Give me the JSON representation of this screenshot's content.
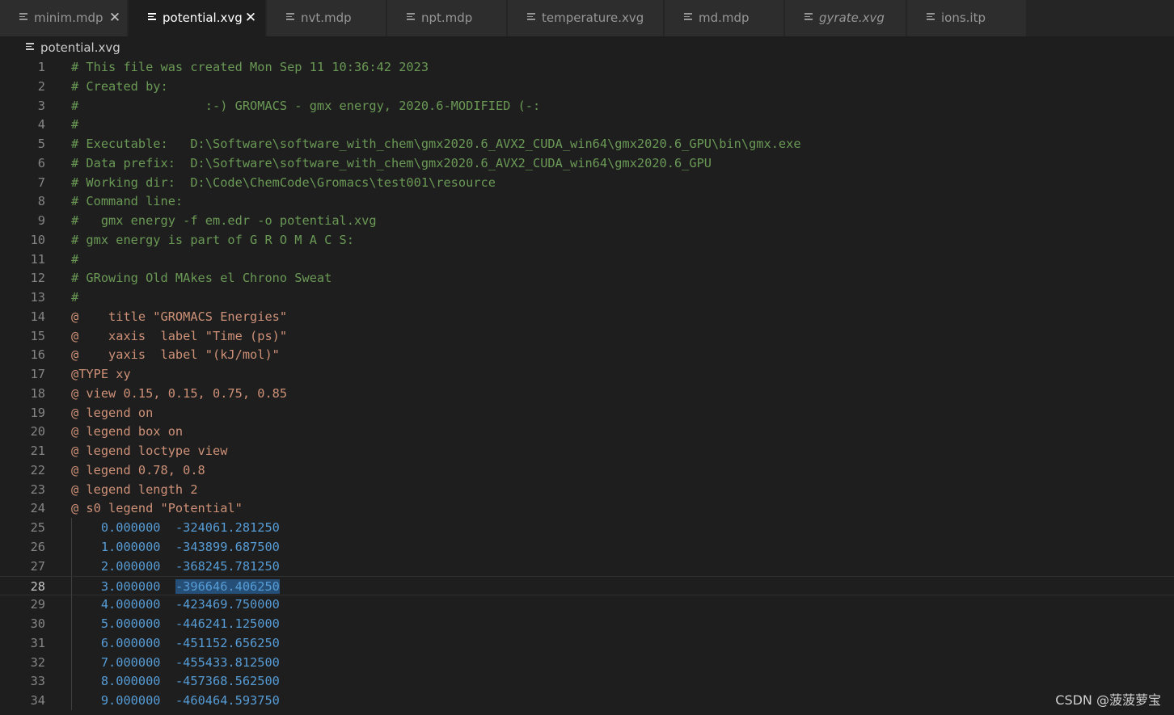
{
  "tabs": [
    {
      "label": "minim.mdp",
      "italic": false,
      "active": false,
      "close": true
    },
    {
      "label": "potential.xvg",
      "italic": false,
      "active": true,
      "close": true
    },
    {
      "label": "nvt.mdp",
      "italic": false,
      "active": false,
      "close": false
    },
    {
      "label": "npt.mdp",
      "italic": false,
      "active": false,
      "close": false
    },
    {
      "label": "temperature.xvg",
      "italic": false,
      "active": false,
      "close": false
    },
    {
      "label": "md.mdp",
      "italic": false,
      "active": false,
      "close": false
    },
    {
      "label": "gyrate.xvg",
      "italic": true,
      "active": false,
      "close": false
    },
    {
      "label": "ions.itp",
      "italic": false,
      "active": false,
      "close": false
    }
  ],
  "close_glyph": "✕",
  "breadcrumb": {
    "file": "potential.xvg"
  },
  "editor": {
    "current_line": 28,
    "lines": [
      {
        "n": "1",
        "type": "comment",
        "text": "# This file was created Mon Sep 11 10:36:42 2023"
      },
      {
        "n": "2",
        "type": "comment",
        "text": "# Created by:"
      },
      {
        "n": "3",
        "type": "comment",
        "text": "#                 :-) GROMACS - gmx energy, 2020.6-MODIFIED (-:"
      },
      {
        "n": "4",
        "type": "comment",
        "text": "#"
      },
      {
        "n": "5",
        "type": "comment",
        "text": "# Executable:   D:\\Software\\software_with_chem\\gmx2020.6_AVX2_CUDA_win64\\gmx2020.6_GPU\\bin\\gmx.exe"
      },
      {
        "n": "6",
        "type": "comment",
        "text": "# Data prefix:  D:\\Software\\software_with_chem\\gmx2020.6_AVX2_CUDA_win64\\gmx2020.6_GPU"
      },
      {
        "n": "7",
        "type": "comment",
        "text": "# Working dir:  D:\\Code\\ChemCode\\Gromacs\\test001\\resource"
      },
      {
        "n": "8",
        "type": "comment",
        "text": "# Command line:"
      },
      {
        "n": "9",
        "type": "comment",
        "text": "#   gmx energy -f em.edr -o potential.xvg"
      },
      {
        "n": "10",
        "type": "comment",
        "text": "# gmx energy is part of G R O M A C S:"
      },
      {
        "n": "11",
        "type": "comment",
        "text": "#"
      },
      {
        "n": "12",
        "type": "comment",
        "text": "# GRowing Old MAkes el Chrono Sweat"
      },
      {
        "n": "13",
        "type": "comment",
        "text": "#"
      },
      {
        "n": "14",
        "type": "header",
        "text": "@    title \"GROMACS Energies\""
      },
      {
        "n": "15",
        "type": "header",
        "text": "@    xaxis  label \"Time (ps)\""
      },
      {
        "n": "16",
        "type": "header",
        "text": "@    yaxis  label \"(kJ/mol)\""
      },
      {
        "n": "17",
        "type": "header",
        "text": "@TYPE xy"
      },
      {
        "n": "18",
        "type": "header",
        "text": "@ view 0.15, 0.15, 0.75, 0.85"
      },
      {
        "n": "19",
        "type": "header",
        "text": "@ legend on"
      },
      {
        "n": "20",
        "type": "header",
        "text": "@ legend box on"
      },
      {
        "n": "21",
        "type": "header",
        "text": "@ legend loctype view"
      },
      {
        "n": "22",
        "type": "header",
        "text": "@ legend 0.78, 0.8"
      },
      {
        "n": "23",
        "type": "header",
        "text": "@ legend length 2"
      },
      {
        "n": "24",
        "type": "header",
        "text": "@ s0 legend \"Potential\""
      },
      {
        "n": "25",
        "type": "data",
        "x": "0.000000",
        "y": "-324061.281250"
      },
      {
        "n": "26",
        "type": "data",
        "x": "1.000000",
        "y": "-343899.687500"
      },
      {
        "n": "27",
        "type": "data",
        "x": "2.000000",
        "y": "-368245.781250"
      },
      {
        "n": "28",
        "type": "data",
        "x": "3.000000",
        "y": "-396646.406250",
        "selected": true
      },
      {
        "n": "29",
        "type": "data",
        "x": "4.000000",
        "y": "-423469.750000"
      },
      {
        "n": "30",
        "type": "data",
        "x": "5.000000",
        "y": "-446241.125000"
      },
      {
        "n": "31",
        "type": "data",
        "x": "6.000000",
        "y": "-451152.656250"
      },
      {
        "n": "32",
        "type": "data",
        "x": "7.000000",
        "y": "-455433.812500"
      },
      {
        "n": "33",
        "type": "data",
        "x": "8.000000",
        "y": "-457368.562500"
      },
      {
        "n": "34",
        "type": "data",
        "x": "9.000000",
        "y": "-460464.593750"
      }
    ]
  },
  "watermark": "CSDN @菠菠萝宝",
  "colors": {
    "background": "#1e1e1e",
    "comment": "#6a9955",
    "header": "#ce9178",
    "number": "#569cd6",
    "selection": "#264f78",
    "line_number": "#858585"
  }
}
